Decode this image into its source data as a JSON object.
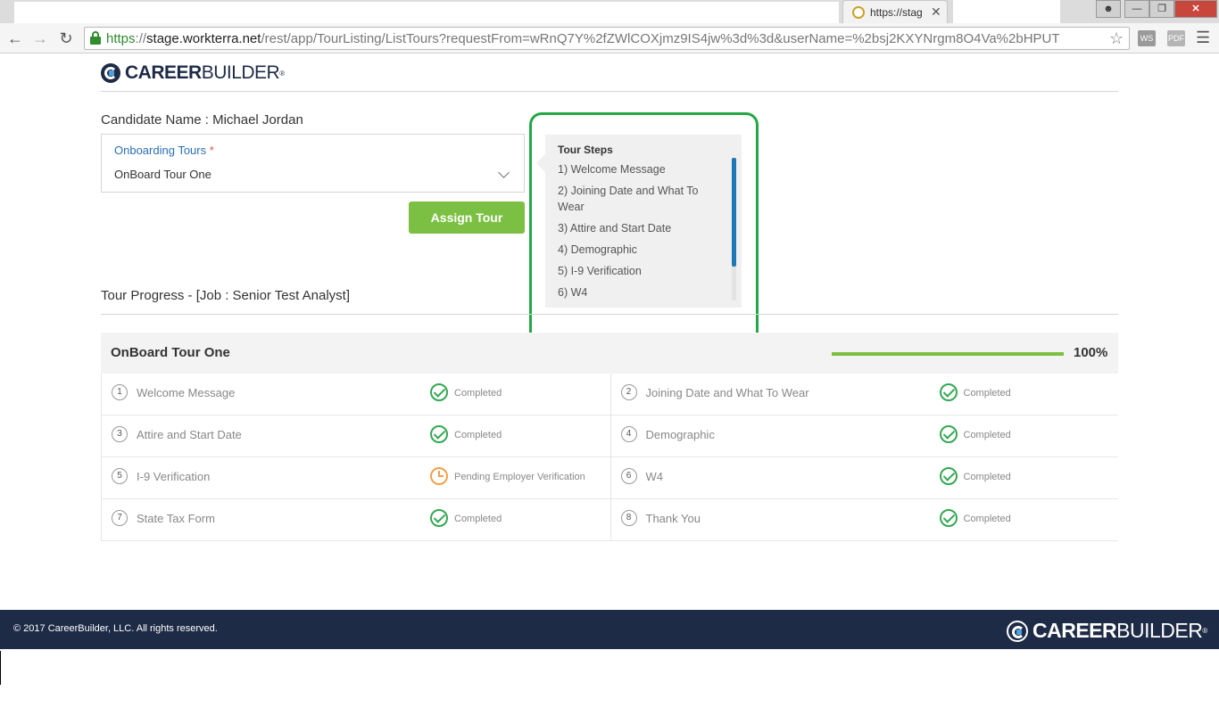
{
  "browser": {
    "tab_title": "https://stag",
    "tab_close": "✕",
    "url_https": "https",
    "url_sep": "://",
    "url_host": "stage.workterra.net",
    "url_path": "/rest/app/TourListing/ListTours?requestFrom=wRnQ7Y%2fZWlCOXjmz9IS4jw%3d%3d&userName=%2bsj2KXYNrgm8O4Va%2bHPUT",
    "ext_ws": "WS",
    "ext_pdf": "PDF"
  },
  "brand": {
    "logo_bold": "CAREER",
    "logo_regular": "BUILDER",
    "tm": "®"
  },
  "candidate": {
    "name_label": "Candidate Name : Michael Jordan"
  },
  "tour_select": {
    "label": "Onboarding Tours",
    "required_mark": "*",
    "value": "OnBoard Tour One"
  },
  "assign_button": "Assign Tour",
  "tour_steps": {
    "title": "Tour Steps",
    "items": [
      "1) Welcome Message",
      "2) Joining Date and What To Wear",
      "3) Attire and Start Date",
      "4) Demographic",
      "5) I-9 Verification",
      "6) W4"
    ]
  },
  "progress": {
    "heading": "Tour Progress - [Job : Senior Test Analyst]",
    "tour_name": "OnBoard Tour One",
    "percent_value": 100,
    "percent_label": "100%",
    "rows": [
      [
        {
          "num": "1",
          "name": "Welcome Message",
          "status": "Completed",
          "state": "ok"
        },
        {
          "num": "2",
          "name": "Joining Date and What To Wear",
          "status": "Completed",
          "state": "ok"
        }
      ],
      [
        {
          "num": "3",
          "name": "Attire and Start Date",
          "status": "Completed",
          "state": "ok"
        },
        {
          "num": "4",
          "name": "Demographic",
          "status": "Completed",
          "state": "ok"
        }
      ],
      [
        {
          "num": "5",
          "name": "I-9 Verification",
          "status": "Pending Employer Verification",
          "state": "pending"
        },
        {
          "num": "6",
          "name": "W4",
          "status": "Completed",
          "state": "ok"
        }
      ],
      [
        {
          "num": "7",
          "name": "State Tax Form",
          "status": "Completed",
          "state": "ok"
        },
        {
          "num": "8",
          "name": "Thank You",
          "status": "Completed",
          "state": "ok"
        }
      ]
    ]
  },
  "footer": {
    "copyright": "© 2017 CareerBuilder, LLC. All rights reserved."
  },
  "colors": {
    "accent_green": "#7cc043",
    "highlight_green": "#23a744",
    "completed_green": "#34a853",
    "pending_orange": "#f0a04b",
    "link_blue": "#2c6fb5",
    "brand_navy": "#1e2b46",
    "scroll_blue": "#1f78b4"
  }
}
